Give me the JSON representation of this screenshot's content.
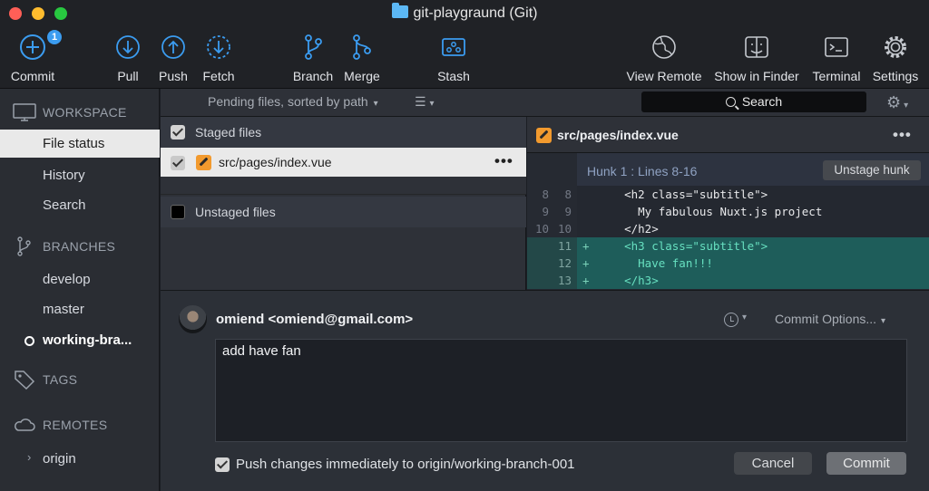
{
  "window": {
    "title": "git-playgraund (Git)"
  },
  "toolbar": {
    "commit": {
      "label": "Commit",
      "badge": "1"
    },
    "pull": {
      "label": "Pull"
    },
    "push": {
      "label": "Push"
    },
    "fetch": {
      "label": "Fetch"
    },
    "branch": {
      "label": "Branch"
    },
    "merge": {
      "label": "Merge"
    },
    "stash": {
      "label": "Stash"
    },
    "view_remote": {
      "label": "View Remote"
    },
    "show_in_finder": {
      "label": "Show in Finder"
    },
    "terminal": {
      "label": "Terminal"
    },
    "settings": {
      "label": "Settings"
    }
  },
  "sidebar": {
    "workspace": {
      "label": "WORKSPACE",
      "icon": "monitor-icon",
      "items": [
        "File status",
        "History",
        "Search"
      ],
      "selected": "File status"
    },
    "branches": {
      "label": "BRANCHES",
      "icon": "branch-icon",
      "items": [
        "develop",
        "master",
        "working-bra..."
      ],
      "current": "working-bra..."
    },
    "tags": {
      "label": "TAGS",
      "icon": "tag-icon"
    },
    "remotes": {
      "label": "REMOTES",
      "icon": "cloud-icon",
      "items": [
        "origin"
      ]
    }
  },
  "file_list": {
    "sort_label": "Pending files, sorted by path",
    "search_placeholder": "Search",
    "staged": {
      "label": "Staged files",
      "checked": true,
      "files": [
        {
          "path": "src/pages/index.vue",
          "status": "modified"
        }
      ]
    },
    "unstaged": {
      "label": "Unstaged files",
      "checked": false
    }
  },
  "diff": {
    "file": "src/pages/index.vue",
    "hunk_title": "Hunk 1 : Lines 8-16",
    "unstage_label": "Unstage hunk",
    "lines": [
      {
        "old": "8",
        "new": "8",
        "marker": "",
        "type": "ctx",
        "code": "    <h2 class=\"subtitle\">"
      },
      {
        "old": "9",
        "new": "9",
        "marker": "",
        "type": "ctx",
        "code": "      My fabulous Nuxt.js project"
      },
      {
        "old": "10",
        "new": "10",
        "marker": "",
        "type": "ctx",
        "code": "    </h2>"
      },
      {
        "old": "",
        "new": "11",
        "marker": "+",
        "type": "add",
        "code": "    <h3 class=\"subtitle\">"
      },
      {
        "old": "",
        "new": "12",
        "marker": "+",
        "type": "add",
        "code": "      Have fan!!!"
      },
      {
        "old": "",
        "new": "13",
        "marker": "+",
        "type": "add",
        "code": "    </h3>"
      }
    ]
  },
  "commit": {
    "author": "omiend <omiend@gmail.com>",
    "options_label": "Commit Options...",
    "message": "add have fan",
    "push_checked": true,
    "push_label": "Push changes immediately to origin/working-branch-001",
    "cancel_label": "Cancel",
    "commit_label": "Commit"
  },
  "colors": {
    "accent": "#3b9cf0",
    "added_bg": "#1e5d5a",
    "added_text": "#67e0c0",
    "modified_badge": "#f29a2e"
  }
}
